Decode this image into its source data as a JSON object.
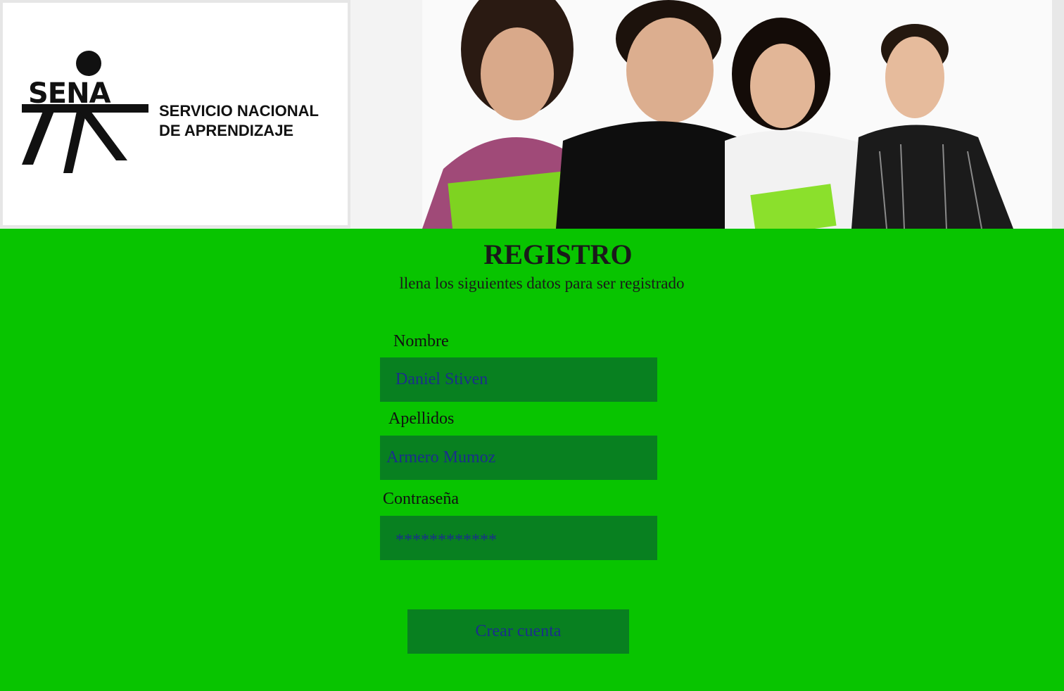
{
  "header": {
    "logo": {
      "word": "SENA",
      "name_line1": "SERVICIO NACIONAL",
      "name_line2": "DE APRENDIZAJE"
    }
  },
  "page": {
    "title": "REGISTRO",
    "subtitle": "llena los siguientes datos para ser registrado"
  },
  "form": {
    "nombre_label": "Nombre",
    "nombre_value": "Daniel Stiven",
    "apellidos_label": "Apellidos",
    "apellidos_value": "Armero Mumoz",
    "password_label": "Contraseña",
    "password_value": "************",
    "submit_label": "Crear cuenta"
  },
  "colors": {
    "background": "#08c400",
    "field_background": "#088020",
    "field_text": "#1a2f8a"
  }
}
